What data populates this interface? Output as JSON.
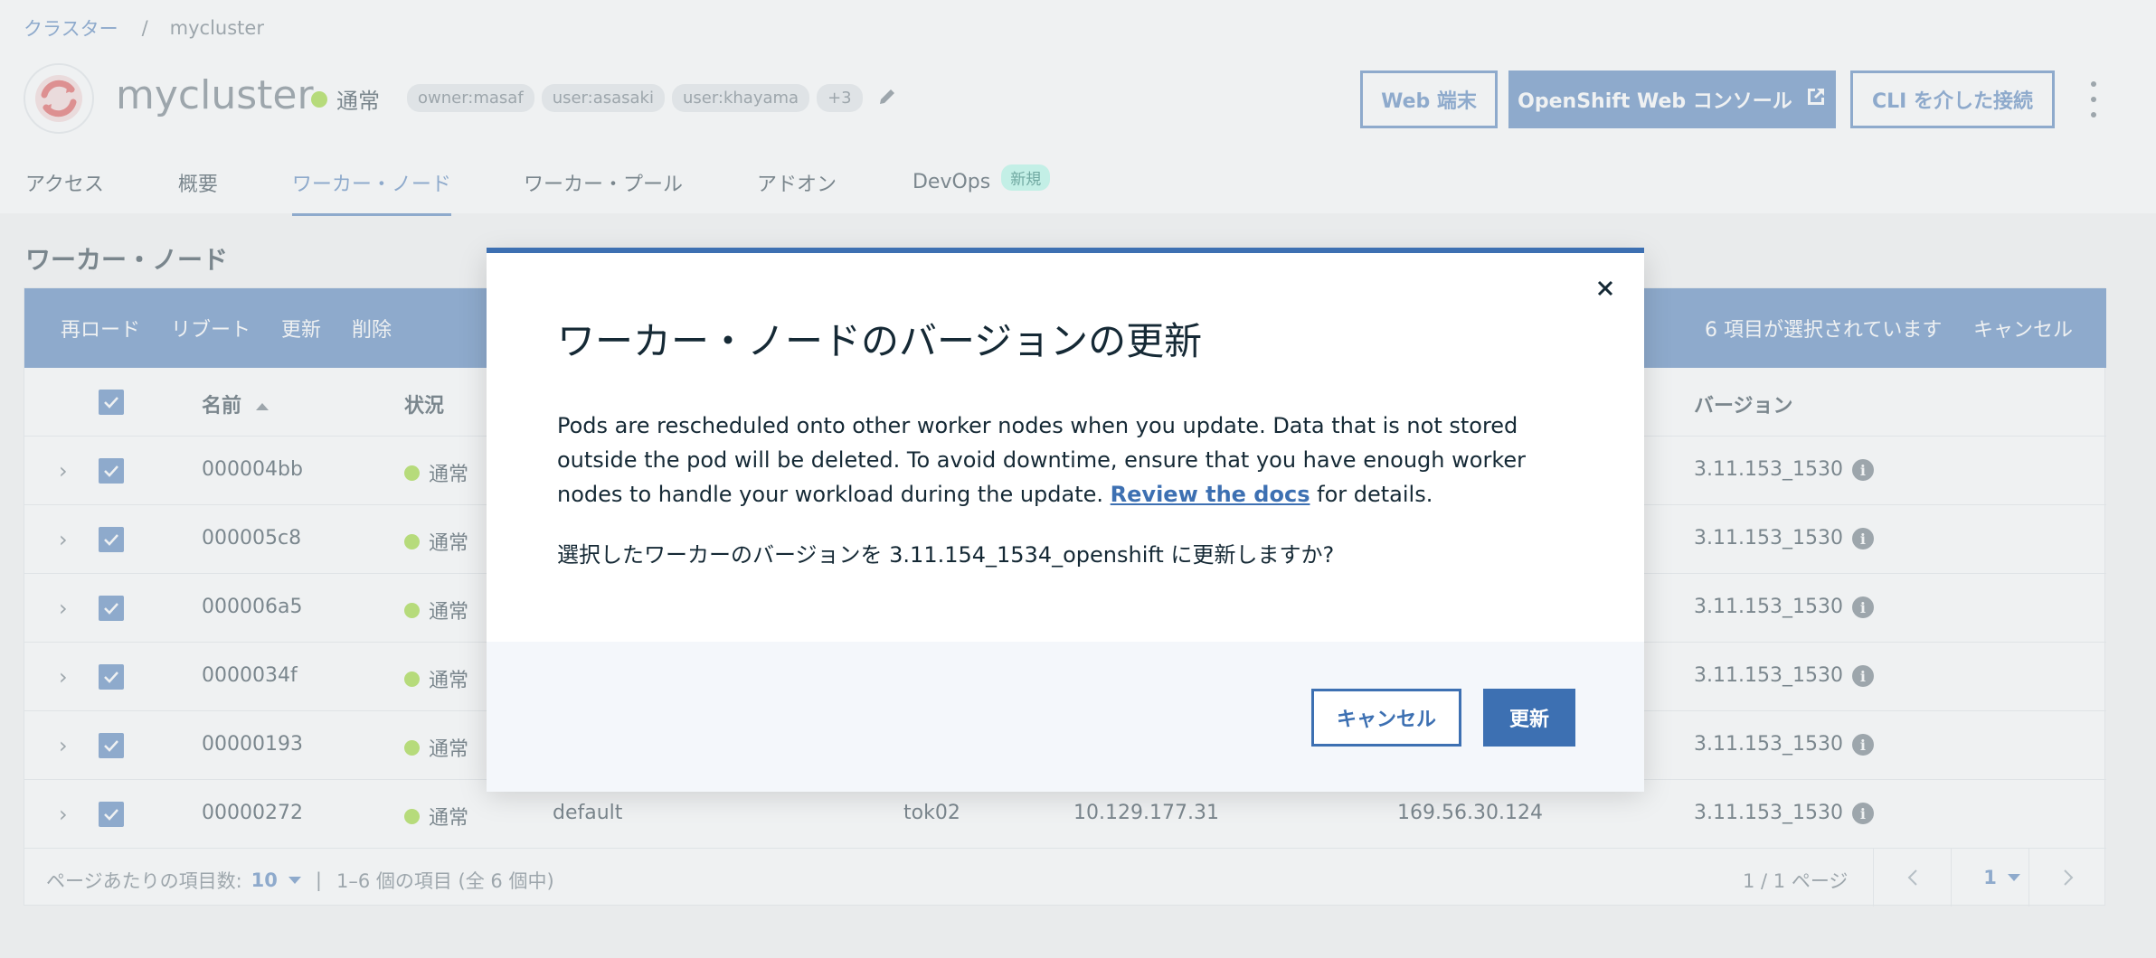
{
  "breadcrumb": {
    "parent": "クラスター",
    "separator": "/",
    "current": "mycluster"
  },
  "cluster": {
    "name": "mycluster",
    "status": "通常",
    "tags": [
      "owner:masaf",
      "user:asasaki",
      "user:khayama",
      "+3"
    ]
  },
  "header_buttons": {
    "web_terminal": "Web 端末",
    "openshift_console": "OpenShift Web コンソール",
    "cli_connect": "CLI を介した接続"
  },
  "tabs": [
    {
      "label": "アクセス"
    },
    {
      "label": "概要"
    },
    {
      "label": "ワーカー・ノード"
    },
    {
      "label": "ワーカー・プール"
    },
    {
      "label": "アドオン"
    },
    {
      "label": "DevOps",
      "badge": "新規"
    }
  ],
  "section_title": "ワーカー・ノード",
  "action_bar": {
    "actions": [
      "再ロード",
      "リブート",
      "更新",
      "削除"
    ],
    "selected_count": "6 項目が選択されています",
    "cancel": "キャンセル"
  },
  "table": {
    "headers": {
      "name": "名前",
      "status": "状況",
      "version": "バージョン"
    },
    "rows": [
      {
        "name": "000004bb",
        "status": "通常",
        "version": "3.11.153_1530"
      },
      {
        "name": "000005c8",
        "status": "通常",
        "version": "3.11.153_1530"
      },
      {
        "name": "000006a5",
        "status": "通常",
        "version": "3.11.153_1530"
      },
      {
        "name": "0000034f",
        "status": "通常",
        "version": "3.11.153_1530"
      },
      {
        "name": "00000193",
        "status": "通常",
        "version": "3.11.153_1530"
      },
      {
        "name": "00000272",
        "status": "通常",
        "pool": "default",
        "zone": "tok02",
        "private_ip": "10.129.177.31",
        "public_ip": "169.56.30.124",
        "version": "3.11.153_1530"
      }
    ]
  },
  "pagination": {
    "per_page_label": "ページあたりの項目数:",
    "per_page": "10",
    "separator": "|",
    "range": "1–6 個の項目 (全 6 個中)",
    "page_count": "1 / 1 ページ",
    "current_page": "1"
  },
  "modal": {
    "title": "ワーカー・ノードのバージョンの更新",
    "body_before": "Pods are rescheduled onto other worker nodes when you update. Data that is not stored outside the pod will be deleted. To avoid downtime, ensure that you have enough worker nodes to handle your workload during the update. ",
    "link": "Review the docs",
    "body_after": " for details.",
    "question": "選択したワーカーのバージョンを 3.11.154_1534_openshift に更新しますか?",
    "cancel": "キャンセル",
    "confirm": "更新"
  },
  "colors": {
    "primary": "#3d70b2",
    "status_ok": "#8cd211",
    "new_badge": "#a7fae6",
    "logo_red": "#db3d3d"
  },
  "icons": {
    "logo": "openshift-logo-icon",
    "edit": "pencil-icon",
    "external": "launch-icon",
    "close": "close-icon",
    "info": "info-icon",
    "expand": "chevron-right-icon"
  }
}
